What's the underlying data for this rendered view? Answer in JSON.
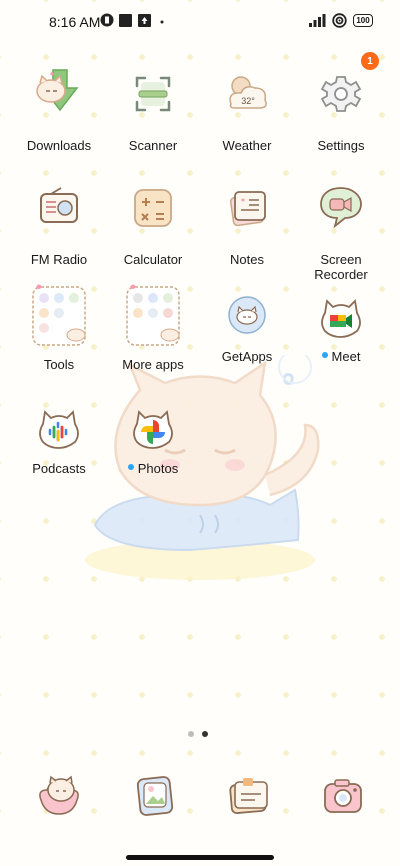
{
  "status_bar": {
    "time": "8:16 AM",
    "battery": "100"
  },
  "apps": [
    {
      "label": "Downloads",
      "icon": "downloads-icon"
    },
    {
      "label": "Scanner",
      "icon": "scanner-icon"
    },
    {
      "label": "Weather",
      "icon": "weather-icon",
      "icon_text": "32°"
    },
    {
      "label": "Settings",
      "icon": "settings-icon",
      "badge": "1"
    },
    {
      "label": "FM Radio",
      "icon": "radio-icon"
    },
    {
      "label": "Calculator",
      "icon": "calculator-icon"
    },
    {
      "label": "Notes",
      "icon": "notes-icon"
    },
    {
      "label": "Screen\nRecorder",
      "icon": "screen-recorder-icon"
    },
    {
      "label": "Tools",
      "icon": "tools-folder-icon"
    },
    {
      "label": "More apps",
      "icon": "more-apps-folder-icon"
    },
    {
      "label": "GetApps",
      "icon": "getapps-icon"
    },
    {
      "label": "Meet",
      "icon": "meet-icon"
    },
    {
      "label": "Podcasts",
      "icon": "podcasts-icon"
    },
    {
      "label": "Photos",
      "icon": "photos-icon"
    }
  ],
  "page_indicator": {
    "pages": 2,
    "current": 2
  },
  "dock": [
    {
      "icon": "phone-icon"
    },
    {
      "icon": "gallery-icon"
    },
    {
      "icon": "messages-icon"
    },
    {
      "icon": "camera-icon"
    }
  ],
  "colors": {
    "badge": "#ff6a1a",
    "new_dot": "#2aa5f5",
    "wallpaper_dots": "#f7f0c8"
  }
}
